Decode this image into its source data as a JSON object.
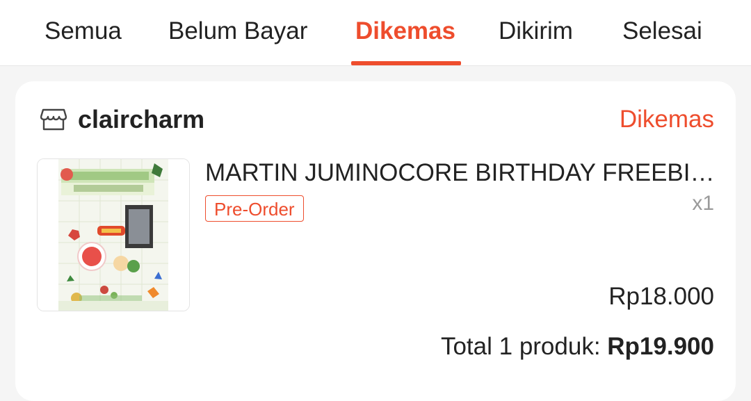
{
  "tabs": [
    {
      "label": "Semua",
      "active": false
    },
    {
      "label": "Belum Bayar",
      "active": false
    },
    {
      "label": "Dikemas",
      "active": true
    },
    {
      "label": "Dikirim",
      "active": false
    },
    {
      "label": "Selesai",
      "active": false
    }
  ],
  "colors": {
    "accent": "#ee4d2d",
    "text": "#222222",
    "muted": "#9a9a9a",
    "background": "#f5f5f5"
  },
  "order": {
    "shop_icon": "store-icon",
    "shop_name": "claircharm",
    "status": "Dikemas",
    "product": {
      "title": "MARTIN JUMINOCORE BIRTHDAY FREEBIES PACK",
      "badge": "Pre-Order",
      "quantity": "x1",
      "price": "Rp18.000"
    },
    "total_label": "Total 1 produk: ",
    "total_amount": "Rp19.900"
  }
}
